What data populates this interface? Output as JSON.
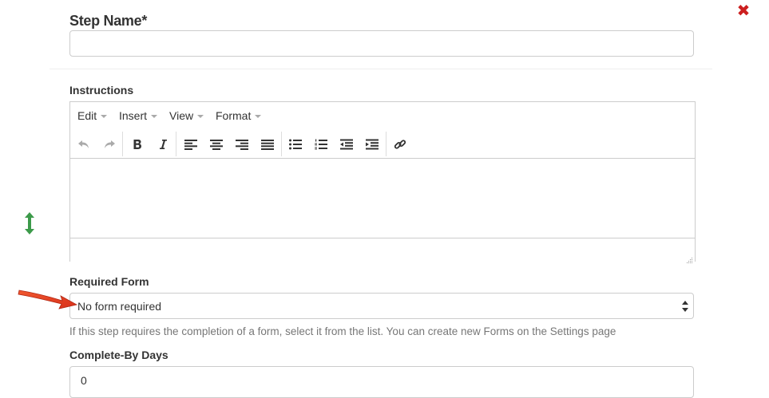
{
  "form": {
    "step_name_label": "Step Name*",
    "step_name_value": "",
    "instructions_label": "Instructions",
    "editor": {
      "menus": [
        {
          "label": "Edit"
        },
        {
          "label": "Insert"
        },
        {
          "label": "View"
        },
        {
          "label": "Format"
        }
      ],
      "toolbar_icons": [
        "undo-icon",
        "redo-icon",
        "bold-icon",
        "italic-icon",
        "align-left-icon",
        "align-center-icon",
        "align-right-icon",
        "align-justify-icon",
        "bullet-list-icon",
        "numbered-list-icon",
        "outdent-icon",
        "indent-icon",
        "link-icon"
      ],
      "content": ""
    },
    "required_form_label": "Required Form",
    "required_form_selected": "No form required",
    "required_form_help": "If this step requires the completion of a form, select it from the list. You can create new Forms on the Settings page",
    "complete_by_days_label": "Complete-By Days",
    "complete_by_days_value": "0"
  },
  "icons": {
    "close": "close-icon",
    "drag": "vertical-resize-icon",
    "annotation": "red-arrow-annotation"
  },
  "colors": {
    "close_red": "#cc1f1f",
    "drag_green": "#3c9a4a",
    "arrow_red": "#e53a1f",
    "help_text": "#777777",
    "border": "#cccccc"
  }
}
